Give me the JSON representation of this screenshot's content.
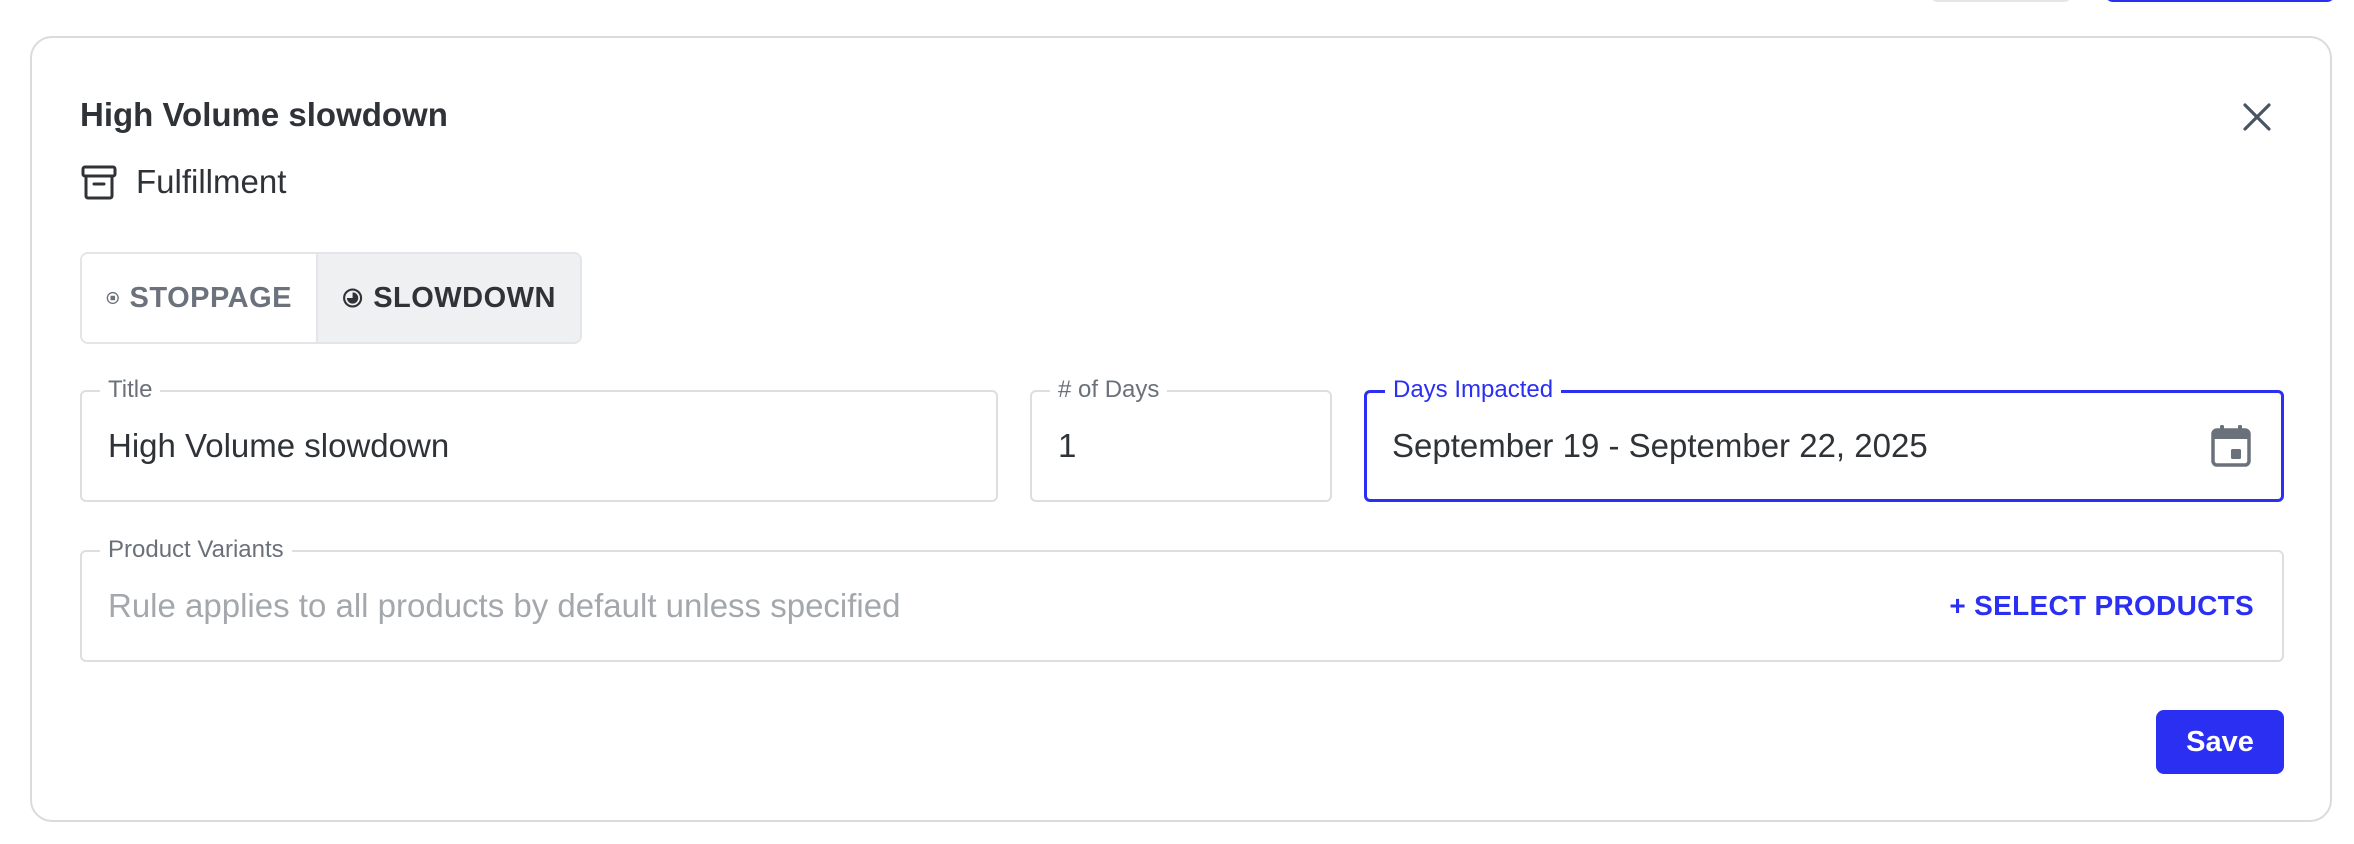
{
  "card": {
    "title": "High Volume slowdown",
    "category": {
      "icon": "archive-box-icon",
      "label": "Fulfillment"
    }
  },
  "mode_toggle": {
    "options": [
      {
        "label": "STOPPAGE",
        "icon": "stop-circle-icon",
        "selected": false
      },
      {
        "label": "SLOWDOWN",
        "icon": "half-circle-icon",
        "selected": true
      }
    ]
  },
  "form": {
    "title": {
      "label": "Title",
      "value": "High Volume slowdown"
    },
    "days": {
      "label": "# of Days",
      "value": "1"
    },
    "days_impacted": {
      "label": "Days Impacted",
      "value": "September 19 - September 22, 2025",
      "icon": "calendar-icon"
    },
    "product_variants": {
      "label": "Product Variants",
      "placeholder": "Rule applies to all products by default unless specified",
      "action_label": "+ SELECT PRODUCTS"
    }
  },
  "actions": {
    "save_label": "Save"
  },
  "colors": {
    "accent": "#2b2ff2",
    "border": "#dcdee1",
    "text": "#2f3337",
    "muted": "#6b717a"
  }
}
